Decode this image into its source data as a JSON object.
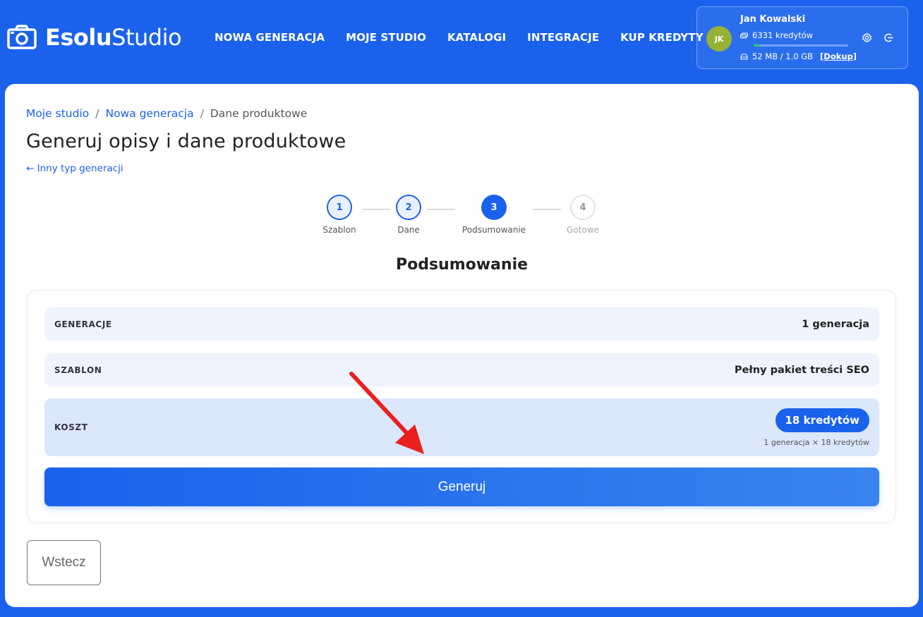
{
  "brand": {
    "bold": "Esolu",
    "regular": "Studio"
  },
  "nav": [
    {
      "label": "NOWA GENERACJA"
    },
    {
      "label": "MOJE STUDIO"
    },
    {
      "label": "KATALOGI"
    },
    {
      "label": "INTEGRACJE"
    },
    {
      "label": "KUP KREDYTY"
    }
  ],
  "user": {
    "initials": "JK",
    "name": "Jan Kowalski",
    "credits": "6331 kredytów",
    "credit_level": 0.07,
    "storage": "52 MB / 1.0 GB",
    "topup": "[Dokup]"
  },
  "breadcrumb": [
    {
      "label": "Moje studio"
    },
    {
      "label": "Nowa generacja"
    },
    {
      "label": "Dane produktowe"
    }
  ],
  "page": {
    "title": "Generuj opisy i dane produktowe",
    "back_link": "← Inny typ generacji"
  },
  "steps": [
    {
      "number": "1",
      "label": "Szablon",
      "state": "done"
    },
    {
      "number": "2",
      "label": "Dane",
      "state": "done"
    },
    {
      "number": "3",
      "label": "Podsumowanie",
      "state": "active"
    },
    {
      "number": "4",
      "label": "Gotowe",
      "state": "todo"
    }
  ],
  "summary": {
    "title": "Podsumowanie",
    "generations_label": "GENERACJE",
    "generations_value": "1 generacja",
    "template_label": "SZABLON",
    "template_value": "Pełny pakiet treści SEO",
    "cost_label": "KOSZT",
    "cost_value": "18 kredytów",
    "cost_detail": "1 generacja × 18 kredytów"
  },
  "buttons": {
    "generate": "Generuj",
    "back": "Wstecz"
  },
  "colors": {
    "primary": "#1a62ec",
    "annotation_arrow": "#e8201e",
    "avatar": "#96b235"
  }
}
